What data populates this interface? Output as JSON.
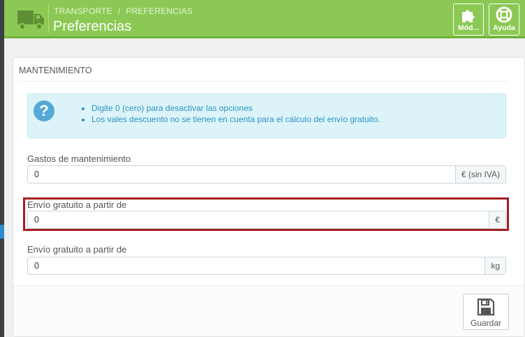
{
  "header": {
    "breadcrumb": [
      "TRANSPORTE",
      "PREFERENCIAS"
    ],
    "breadcrumb_separator": "/",
    "title": "Preferencias",
    "icon": "truck-icon",
    "toolbar": {
      "modules_label": "Mód...",
      "modules_icon": "puzzle-icon",
      "help_label": "Ayuda",
      "help_icon": "lifebuoy-icon"
    },
    "color": "#8bc954"
  },
  "panel": {
    "heading": "MANTENIMIENTO",
    "alert": {
      "icon": "question-icon",
      "items": [
        "Digite 0 (cero) para desactivar las opciones",
        "Los vales descuento no se tienen en cuenta para el cálculo del envío gratuito."
      ]
    },
    "fields": [
      {
        "label": "Gastos de mantenimiento",
        "value": "0",
        "suffix": "€ (sin IVA)"
      },
      {
        "label": "Envío gratuito a partir de",
        "value": "0",
        "suffix": "€",
        "highlighted": true
      },
      {
        "label": "Envío gratuito a partir de",
        "value": "0",
        "suffix": "kg"
      }
    ],
    "save_label": "Guardar",
    "save_icon": "floppy-disk-icon"
  },
  "highlight_color": "#a41f1f"
}
